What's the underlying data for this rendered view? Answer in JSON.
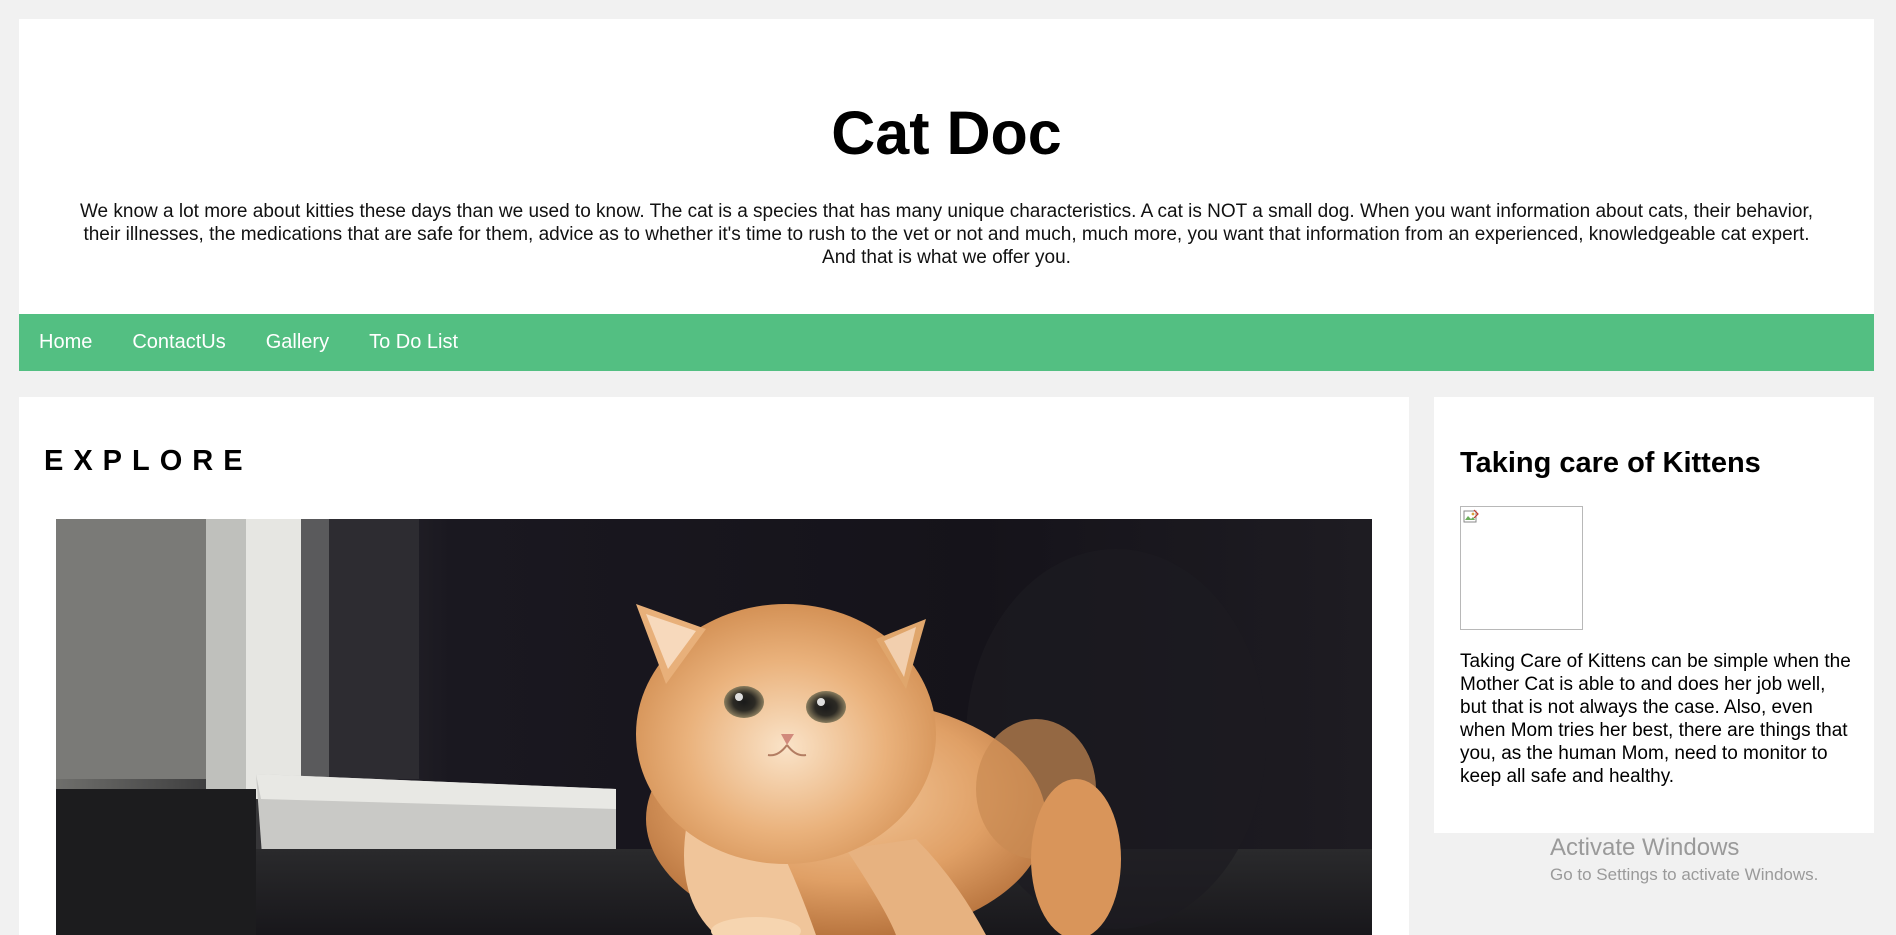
{
  "header": {
    "title": "Cat Doc",
    "intro": "We know a lot more about kitties these days than we used to know. The cat is a species that has many unique characteristics. A cat is NOT a small dog. When you want information about cats, their behavior, their illnesses, the medications that are safe for them, advice as to whether it's time to rush to the vet or not and much, much more, you want that information from an experienced, knowledgeable cat expert. And that is what we offer you."
  },
  "nav": {
    "items": [
      {
        "label": "Home"
      },
      {
        "label": "ContactUs"
      },
      {
        "label": "Gallery"
      },
      {
        "label": "To Do List"
      }
    ],
    "background": "#53bf82"
  },
  "main": {
    "section_title": "EXPLORE",
    "hero_image": "kitten-photo"
  },
  "sidebar": {
    "title": "Taking care of Kittens",
    "image": "broken-image-icon",
    "text": "Taking Care of Kittens can be simple when the Mother Cat is able to and does her job well, but that is not always the case. Also, even when Mom tries her best, there are things that you, as the human Mom, need to monitor to keep all safe and healthy."
  },
  "watermark": {
    "title": "Activate Windows",
    "subtitle": "Go to Settings to activate Windows."
  }
}
